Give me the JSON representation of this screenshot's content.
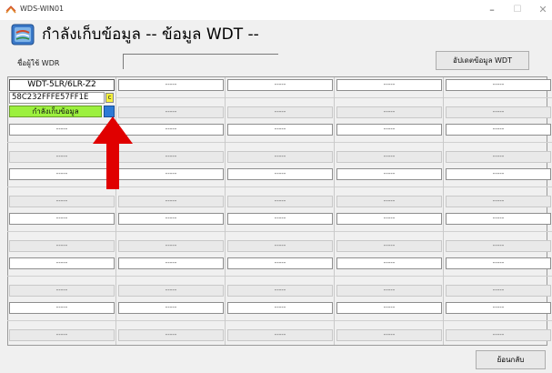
{
  "window": {
    "title": "WDS-WIN01",
    "minimize_glyph": "–",
    "maximize_glyph": "☐",
    "close_glyph": "✕"
  },
  "header": {
    "title": "กำลังเก็บข้อมูล -- ข้อมูล WDT --",
    "icon": "wdt-device-icon"
  },
  "user": {
    "label": "ชื่อผู้ใช้ WDR",
    "value": ""
  },
  "buttons": {
    "update": "อัปเดตข้อมูล WDT",
    "back": "ย้อนกลับ"
  },
  "grid": {
    "active_cell": {
      "model": "WDT-5LR/6LR-Z2",
      "id": "58C232FFFE57FF1E",
      "badge": "c",
      "status": "กำลังเก็บข้อมูล"
    },
    "placeholder": "-----"
  },
  "colors": {
    "status_green": "#9cf03e",
    "badge_yellow": "#f5f03c",
    "indicator_blue": "#2d7ad6",
    "arrow_red": "#e00000"
  }
}
